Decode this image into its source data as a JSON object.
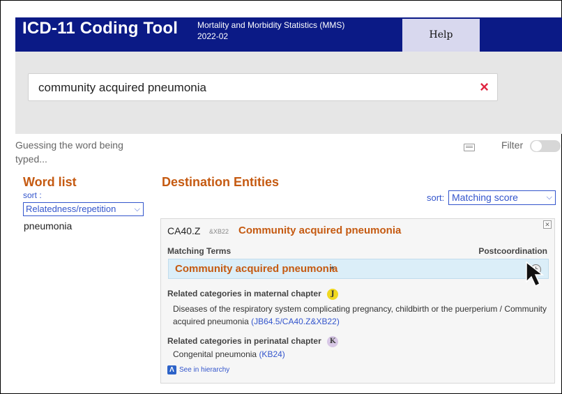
{
  "header": {
    "app_title": "ICD-11 Coding Tool",
    "subtitle_line1": "Mortality and Morbidity Statistics (MMS)",
    "subtitle_line2": "2022-02",
    "help_tab": "Help"
  },
  "search": {
    "value": "community acquired pneumonia",
    "clear_icon": "×"
  },
  "status": {
    "guessing_text": "Guessing the word being typed...",
    "filter_label": "Filter",
    "filter_on": false
  },
  "word_list": {
    "title": "Word list",
    "sort_label": "sort :",
    "sort_value": "Relatedness/repetition",
    "items": [
      "pneumonia"
    ]
  },
  "destination": {
    "title": "Destination Entities",
    "sort_label": "sort:",
    "sort_value": "Matching score",
    "entity": {
      "code": "CA40.Z",
      "postcoord_suffix": "&XB22",
      "title": "Community acquired pneumonia",
      "matching_terms_label": "Matching Terms",
      "postcoordination_label": "Postcoordination",
      "matching_term": "Community acquired pneumonia",
      "matching_term_mark": "*",
      "maternal_heading": "Related categories in maternal chapter",
      "maternal_badge": "J",
      "maternal_text": "Diseases of the respiratory system complicating pregnancy, childbirth or the puerperium / Community acquired pneumonia",
      "maternal_code": "(JB64.5/CA40.Z&XB22)",
      "perinatal_heading": "Related categories in perinatal chapter",
      "perinatal_badge": "K",
      "perinatal_text": "Congenital pneumonia",
      "perinatal_code": "(KB24)",
      "hierarchy_link": "See in hierarchy"
    }
  },
  "colors": {
    "header_bg": "#0b1a86",
    "accent_orange": "#c55a11",
    "link_blue": "#3355cc",
    "clear_red": "#e0243f"
  }
}
